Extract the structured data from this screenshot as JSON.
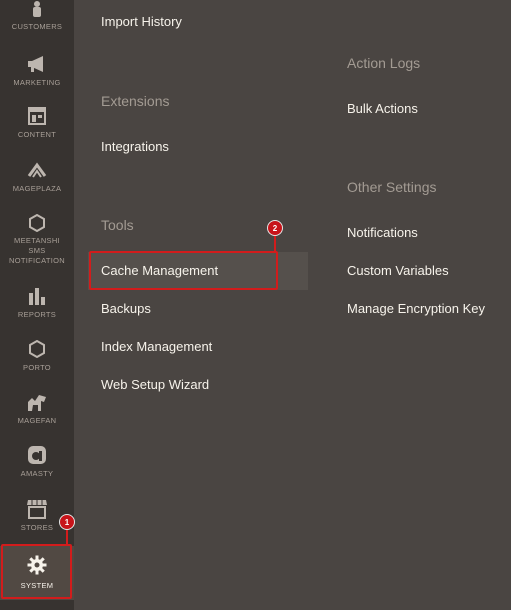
{
  "sidebar": {
    "items": [
      {
        "label": "CUSTOMERS",
        "icon": "customers-icon"
      },
      {
        "label": "MARKETING",
        "icon": "megaphone-icon"
      },
      {
        "label": "CONTENT",
        "icon": "content-icon"
      },
      {
        "label": "MAGEPLAZA",
        "icon": "mageplaza-icon"
      },
      {
        "label": "MEETANSHI\nSMS\nNOTIFICATION",
        "icon": "hexagon-icon"
      },
      {
        "label": "REPORTS",
        "icon": "bar-chart-icon"
      },
      {
        "label": "PORTO",
        "icon": "hexagon-icon"
      },
      {
        "label": "MAGEFAN",
        "icon": "magefan-icon"
      },
      {
        "label": "AMASTY",
        "icon": "amasty-icon"
      },
      {
        "label": "STORES",
        "icon": "store-icon"
      },
      {
        "label": "SYSTEM",
        "icon": "gear-icon"
      }
    ]
  },
  "menu": {
    "left": {
      "import_history": "Import History",
      "extensions_heading": "Extensions",
      "integrations": "Integrations",
      "tools_heading": "Tools",
      "cache_management": "Cache Management",
      "backups": "Backups",
      "index_management": "Index Management",
      "web_setup_wizard": "Web Setup Wizard"
    },
    "right": {
      "action_logs_heading": "Action Logs",
      "bulk_actions": "Bulk Actions",
      "other_settings_heading": "Other Settings",
      "notifications": "Notifications",
      "custom_variables": "Custom Variables",
      "manage_encryption_key": "Manage Encryption Key"
    }
  },
  "callouts": {
    "step1": "1",
    "step2": "2"
  },
  "colors": {
    "highlight": "#d21c1c",
    "sidebar_bg": "#373330",
    "flyout_bg": "#4a4542"
  }
}
